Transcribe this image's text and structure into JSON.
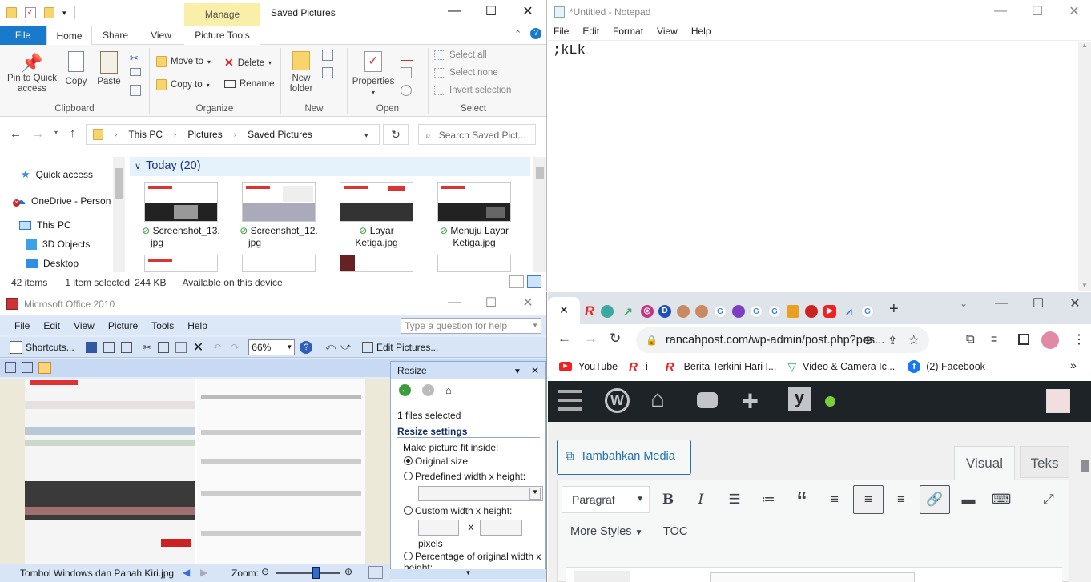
{
  "explorer": {
    "manage_tab": "Manage",
    "title": "Saved Pictures",
    "tabs": {
      "file": "File",
      "home": "Home",
      "share": "Share",
      "view": "View",
      "picture_tools": "Picture Tools"
    },
    "clipboard": {
      "pin": "Pin to Quick access",
      "copy": "Copy",
      "paste": "Paste",
      "label": "Clipboard"
    },
    "organize": {
      "move_to": "Move to",
      "copy_to": "Copy to",
      "delete": "Delete",
      "rename": "Rename",
      "label": "Organize"
    },
    "new": {
      "new_folder": "New folder",
      "label": "New"
    },
    "open": {
      "properties": "Properties",
      "label": "Open"
    },
    "select": {
      "select_all": "Select all",
      "select_none": "Select none",
      "invert": "Invert selection",
      "label": "Select"
    },
    "breadcrumb": [
      "This PC",
      "Pictures",
      "Saved Pictures"
    ],
    "search_placeholder": "Search Saved Pict...",
    "nav": {
      "quick_access": "Quick access",
      "onedrive": "OneDrive - Person",
      "this_pc": "This PC",
      "objects3d": "3D Objects",
      "desktop": "Desktop"
    },
    "group_header": "Today (20)",
    "files": [
      {
        "line1": "Screenshot_13.",
        "line2": "jpg"
      },
      {
        "line1": "Screenshot_12.",
        "line2": "jpg"
      },
      {
        "line1": "Layar",
        "line2": "Ketiga.jpg"
      },
      {
        "line1": "Menuju Layar",
        "line2": "Ketiga.jpg"
      }
    ],
    "status": {
      "items": "42 items",
      "selected": "1 item selected",
      "size": "244 KB",
      "availability": "Available on this device"
    }
  },
  "notepad": {
    "title": "*Untitled - Notepad",
    "menu": [
      "File",
      "Edit",
      "Format",
      "View",
      "Help"
    ],
    "text": ";kLk"
  },
  "office": {
    "title": "Microsoft Office 2010",
    "menu": [
      "File",
      "Edit",
      "View",
      "Picture",
      "Tools",
      "Help"
    ],
    "question_placeholder": "Type a question for help",
    "shortcuts": "Shortcuts...",
    "zoom": "66%",
    "edit_pictures": "Edit Pictures...",
    "pane_title": "Resize",
    "files_selected": "1 files selected",
    "resize_settings": "Resize settings",
    "fit_inside": "Make picture fit inside:",
    "original_size": "Original size",
    "predefined": "Predefined width x height:",
    "custom": "Custom width x height:",
    "x": "x",
    "pixels": "pixels",
    "percentage": "Percentage of original width x height:",
    "filename": "Tombol Windows dan Panah Kiri.jpg",
    "zoom_label": "Zoom:",
    "zoom_level": 0.6
  },
  "chrome": {
    "url": "rancahpost.com/wp-admin/post.php?pos...",
    "bookmarks": {
      "youtube": "YouTube",
      "r_i": "i",
      "berita": "Berita Terkini Hari I...",
      "video": "Video & Camera Ic...",
      "facebook": "(2) Facebook"
    },
    "tambahkan_media": "Tambahkan Media",
    "tab_visual": "Visual",
    "tab_teks": "Teks",
    "paragraph": "Paragraf",
    "more_styles": "More Styles",
    "toc": "TOC"
  }
}
